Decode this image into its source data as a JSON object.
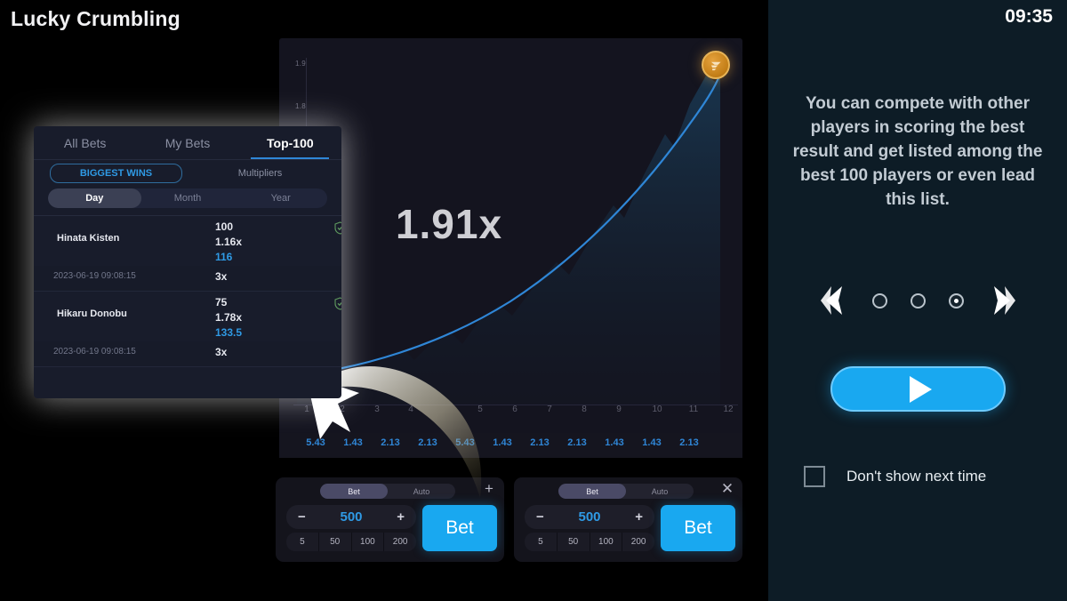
{
  "game": {
    "title": "Lucky Crumbling",
    "current_multiplier": "1.91x",
    "coin_icon": "coin-token-icon"
  },
  "chart_data": {
    "type": "line",
    "title": "",
    "xlabel": "",
    "ylabel": "",
    "x_ticks": [
      "1",
      "2",
      "3",
      "4",
      "5",
      "6",
      "7",
      "8",
      "9",
      "10",
      "11",
      "12"
    ],
    "y_ticks": [
      "1.9",
      "1.8"
    ],
    "ylim": [
      1.0,
      1.95
    ],
    "xlim": [
      0,
      12
    ],
    "grid": false,
    "legend": "none",
    "series": [
      {
        "name": "multiplier-curve",
        "x": [
          0.5,
          2,
          3.5,
          5,
          6.5,
          8,
          9,
          10,
          10.8,
          11.4,
          11.8
        ],
        "values": [
          1.0,
          1.05,
          1.12,
          1.2,
          1.3,
          1.42,
          1.52,
          1.64,
          1.75,
          1.85,
          1.91
        ]
      }
    ],
    "history": [
      "5.43",
      "1.43",
      "2.13",
      "2.13",
      "5.43",
      "1.43",
      "2.13",
      "2.13",
      "1.43",
      "1.43",
      "2.13"
    ]
  },
  "bet_panels": [
    {
      "mode_bet": "Bet",
      "mode_auto": "Auto",
      "active_mode": "Bet",
      "minus": "−",
      "plus": "+",
      "stake": "500",
      "quick_amounts": [
        "5",
        "50",
        "100",
        "200"
      ],
      "action_label": "Bet",
      "corner_icon": "plus-icon",
      "corner_glyph": "+"
    },
    {
      "mode_bet": "Bet",
      "mode_auto": "Auto",
      "active_mode": "Bet",
      "minus": "−",
      "plus": "+",
      "stake": "500",
      "quick_amounts": [
        "5",
        "50",
        "100",
        "200"
      ],
      "action_label": "Bet",
      "corner_icon": "close-icon",
      "corner_glyph": "✕"
    }
  ],
  "top100": {
    "tabs": [
      {
        "label": "All Bets",
        "active": false
      },
      {
        "label": "My Bets",
        "active": false
      },
      {
        "label": "Top-100",
        "active": true
      }
    ],
    "subtabs": [
      {
        "label": "BIGGEST WINS",
        "active": true
      },
      {
        "label": "Multipliers",
        "active": false
      }
    ],
    "periods": [
      {
        "label": "Day",
        "active": true
      },
      {
        "label": "Month",
        "active": false
      },
      {
        "label": "Year",
        "active": false
      }
    ],
    "entries": [
      {
        "name": "Hinata Kisten",
        "amount": "100",
        "multiplier": "1.16x",
        "payout": "116",
        "timestamp": "2023-06-19  09:08:15",
        "cashout": "3x",
        "verified_icon": "shield-check-icon"
      },
      {
        "name": "Hikaru Donobu",
        "amount": "75",
        "multiplier": "1.78x",
        "payout": "133.5",
        "timestamp": "2023-06-19  09:08:15",
        "cashout": "3x",
        "verified_icon": "shield-check-icon"
      }
    ]
  },
  "side_panel": {
    "clock": "09:35",
    "tutorial_text": "You can compete with other players in scoring the best result and get listed among the best 100 players or even lead this list.",
    "prev_icon": "chevron-left-icon",
    "next_icon": "chevron-right-icon",
    "dots": [
      {
        "active": false
      },
      {
        "active": false
      },
      {
        "active": true
      }
    ],
    "play_icon": "play-icon",
    "dont_show_label": "Don't show next time",
    "dont_show_checked": false
  },
  "colors": {
    "accent_blue": "#19a8f0",
    "curve_blue": "#2f86d6",
    "panel_navy": "#0d1c26",
    "coin_gold": "#c27d16",
    "verified_green": "#4e8a4e"
  }
}
